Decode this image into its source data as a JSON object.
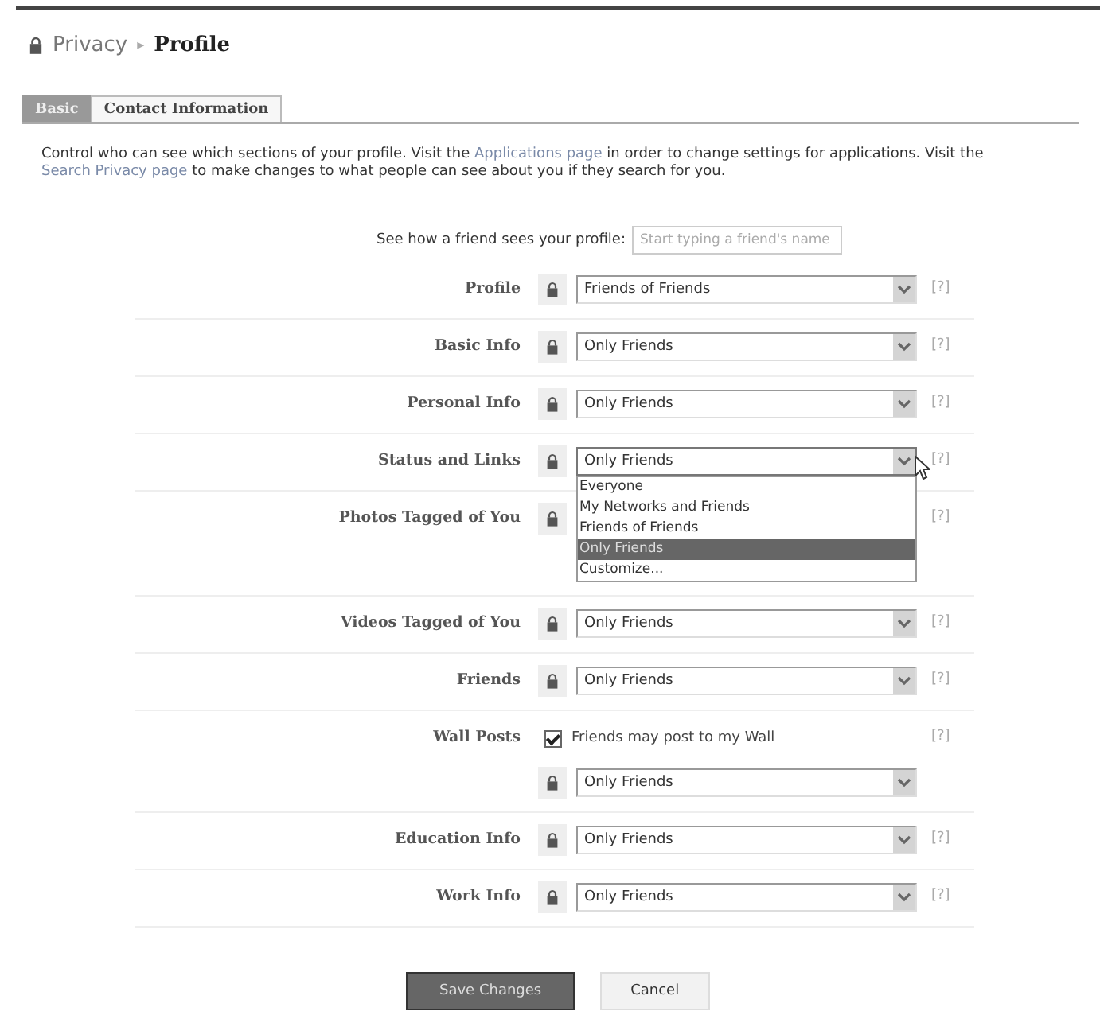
{
  "breadcrumb": {
    "parent": "Privacy",
    "separator": "▸",
    "current": "Profile"
  },
  "tabs": [
    {
      "label": "Basic",
      "selected": true
    },
    {
      "label": "Contact Information",
      "selected": false
    }
  ],
  "intro": [
    {
      "kind": "text",
      "text": "Control who can see which sections of your profile. Visit the "
    },
    {
      "kind": "link",
      "text": "Applications page"
    },
    {
      "kind": "text",
      "text": " in order to change settings for applications. Visit the "
    },
    {
      "kind": "link",
      "text": "Search Privacy page"
    },
    {
      "kind": "text",
      "text": " to make changes to what people can see about you if they search for you."
    }
  ],
  "preview": {
    "label": "See how a friend sees your profile:",
    "placeholder": "Start typing a friend's name"
  },
  "settings": [
    {
      "label": "Profile",
      "kind": "select",
      "value": "Friends of Friends",
      "help": "[?]",
      "expanded": false
    },
    {
      "label": "Basic Info",
      "kind": "select",
      "value": "Only Friends",
      "help": "[?]",
      "expanded": false
    },
    {
      "label": "Personal Info",
      "kind": "select",
      "value": "Only Friends",
      "help": "[?]",
      "expanded": false
    },
    {
      "label": "Status and Links",
      "kind": "select",
      "value": "Only Friends",
      "help": "[?]",
      "expanded": true,
      "options": [
        {
          "label": "Everyone",
          "selected": false
        },
        {
          "label": "My Networks and Friends",
          "selected": false
        },
        {
          "label": "Friends of Friends",
          "selected": false
        },
        {
          "label": "Only Friends",
          "selected": true
        },
        {
          "label": "Customize...",
          "selected": false
        }
      ]
    },
    {
      "label": "Photos Tagged of You",
      "kind": "covered",
      "help": "[?]"
    },
    {
      "label": "Videos Tagged of You",
      "kind": "select",
      "value": "Only Friends",
      "help": "[?]",
      "expanded": false
    },
    {
      "label": "Friends",
      "kind": "select",
      "value": "Only Friends",
      "help": "[?]",
      "expanded": false
    },
    {
      "label": "Wall Posts",
      "kind": "checkbox-select",
      "checkbox": {
        "label": "Friends may post to my Wall",
        "checked": true
      },
      "value": "Only Friends",
      "help": "[?]",
      "expanded": false
    },
    {
      "label": "Education Info",
      "kind": "select",
      "value": "Only Friends",
      "help": "[?]",
      "expanded": false
    },
    {
      "label": "Work Info",
      "kind": "select",
      "value": "Only Friends",
      "help": "[?]",
      "expanded": false
    }
  ],
  "buttons": [
    {
      "label": "Save Changes",
      "kind": "primary"
    },
    {
      "label": "Cancel",
      "kind": "secondary"
    }
  ]
}
